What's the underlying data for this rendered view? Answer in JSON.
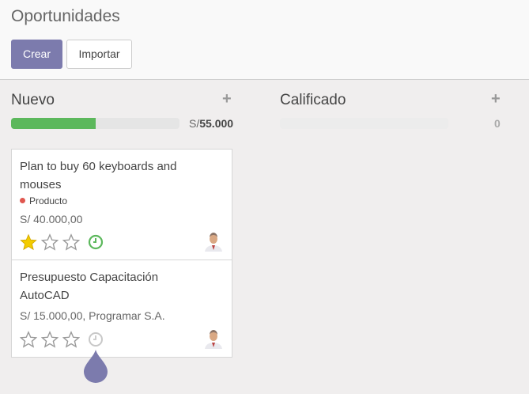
{
  "header": {
    "title": "Oportunidades",
    "create_label": "Crear",
    "import_label": "Importar"
  },
  "columns": [
    {
      "title": "Nuevo",
      "add_label": "+",
      "progress": 0.5,
      "currency": "S/",
      "aggregate": "55.000"
    },
    {
      "title": "Calificado",
      "add_label": "+",
      "progress": 0,
      "aggregate": "0"
    }
  ],
  "cards": [
    {
      "title": "Plan to buy 60 keyboards and mouses",
      "tag": "Producto",
      "meta": "S/ 40.000,00",
      "stars": 1,
      "activity": "green"
    },
    {
      "title": "Presupuesto Capacitación AutoCAD",
      "tag": "",
      "meta": "S/ 15.000,00, Programar S.A.",
      "stars": 0,
      "activity": "grey"
    }
  ],
  "colors": {
    "primary": "#7c7bad",
    "progress": "#5cb85c",
    "star": "#f3cc00",
    "tag": "#e0574f"
  }
}
